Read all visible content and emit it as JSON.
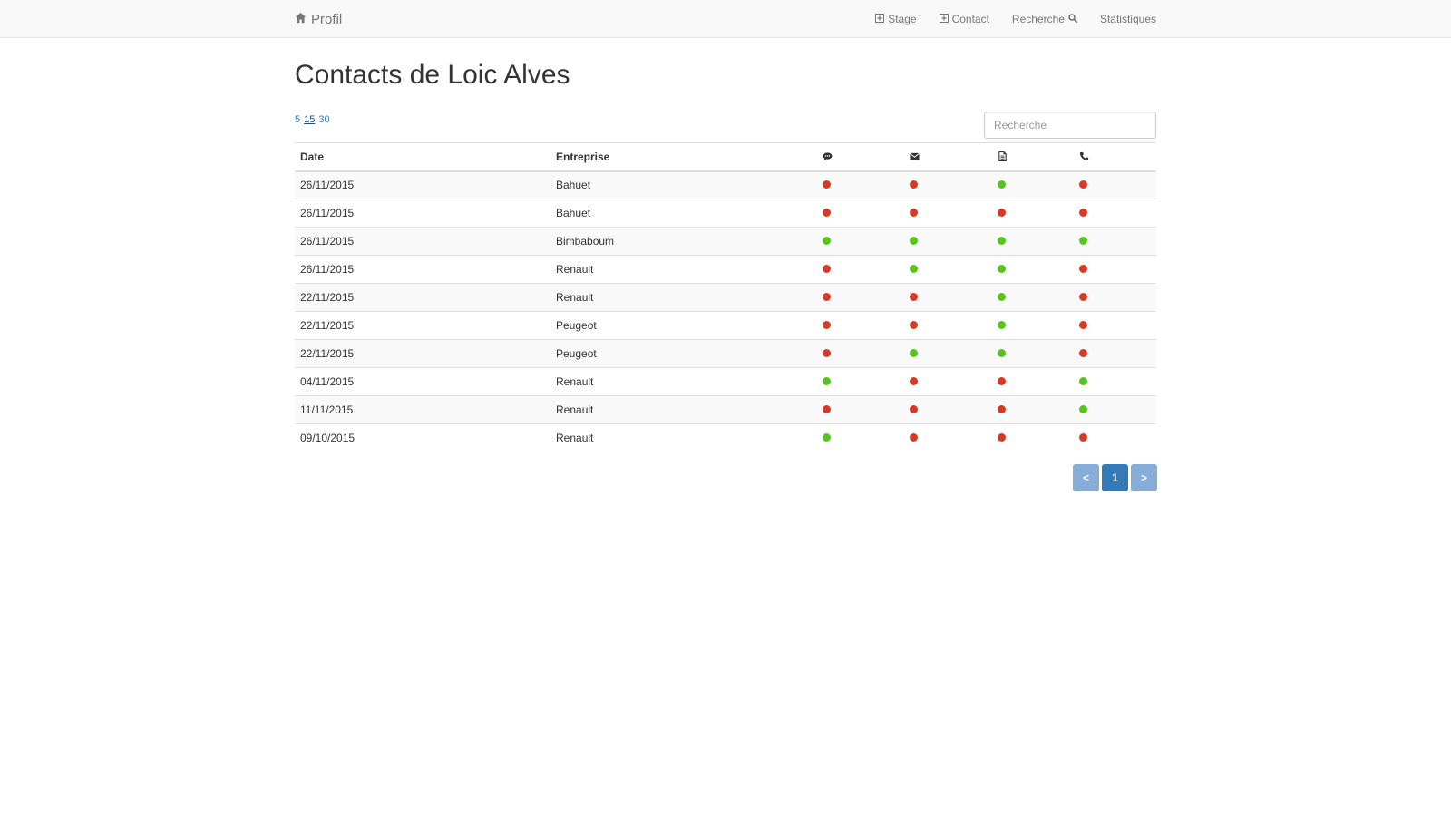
{
  "navbar": {
    "brand": {
      "label": "Profil",
      "icon": "home-icon"
    },
    "links": [
      {
        "label": "Stage",
        "icon": "plus-square-icon"
      },
      {
        "label": "Contact",
        "icon": "plus-square-icon"
      },
      {
        "label": "Recherche",
        "icon": "search-icon"
      },
      {
        "label": "Statistiques"
      }
    ]
  },
  "page_title": "Contacts de Loic Alves",
  "page_size": {
    "options": [
      "5",
      "15",
      "30"
    ],
    "selected": "15"
  },
  "search": {
    "placeholder": "Recherche",
    "value": ""
  },
  "table": {
    "columns": [
      {
        "label": "Date"
      },
      {
        "label": "Entreprise"
      },
      {
        "icon": "comment-icon"
      },
      {
        "icon": "envelope-icon"
      },
      {
        "icon": "document-icon"
      },
      {
        "icon": "phone-icon"
      }
    ],
    "rows": [
      {
        "date": "26/11/2015",
        "entreprise": "Bahuet",
        "status": [
          "red",
          "red",
          "green",
          "red"
        ]
      },
      {
        "date": "26/11/2015",
        "entreprise": "Bahuet",
        "status": [
          "red",
          "red",
          "red",
          "red"
        ]
      },
      {
        "date": "26/11/2015",
        "entreprise": "Bimbaboum",
        "status": [
          "green",
          "green",
          "green",
          "green"
        ]
      },
      {
        "date": "26/11/2015",
        "entreprise": "Renault",
        "status": [
          "red",
          "green",
          "green",
          "red"
        ]
      },
      {
        "date": "22/11/2015",
        "entreprise": "Renault",
        "status": [
          "red",
          "red",
          "green",
          "red"
        ]
      },
      {
        "date": "22/11/2015",
        "entreprise": "Peugeot",
        "status": [
          "red",
          "red",
          "green",
          "red"
        ]
      },
      {
        "date": "22/11/2015",
        "entreprise": "Peugeot",
        "status": [
          "red",
          "green",
          "green",
          "red"
        ]
      },
      {
        "date": "04/11/2015",
        "entreprise": "Renault",
        "status": [
          "green",
          "red",
          "red",
          "green"
        ]
      },
      {
        "date": "11/11/2015",
        "entreprise": "Renault",
        "status": [
          "red",
          "red",
          "red",
          "green"
        ]
      },
      {
        "date": "09/10/2015",
        "entreprise": "Renault",
        "status": [
          "green",
          "red",
          "red",
          "red"
        ]
      }
    ]
  },
  "pagination": {
    "prev": "<",
    "current": "1",
    "next": ">"
  },
  "colors": {
    "red": "#d63a24",
    "green": "#55c41f",
    "primary": "#337ab7"
  }
}
